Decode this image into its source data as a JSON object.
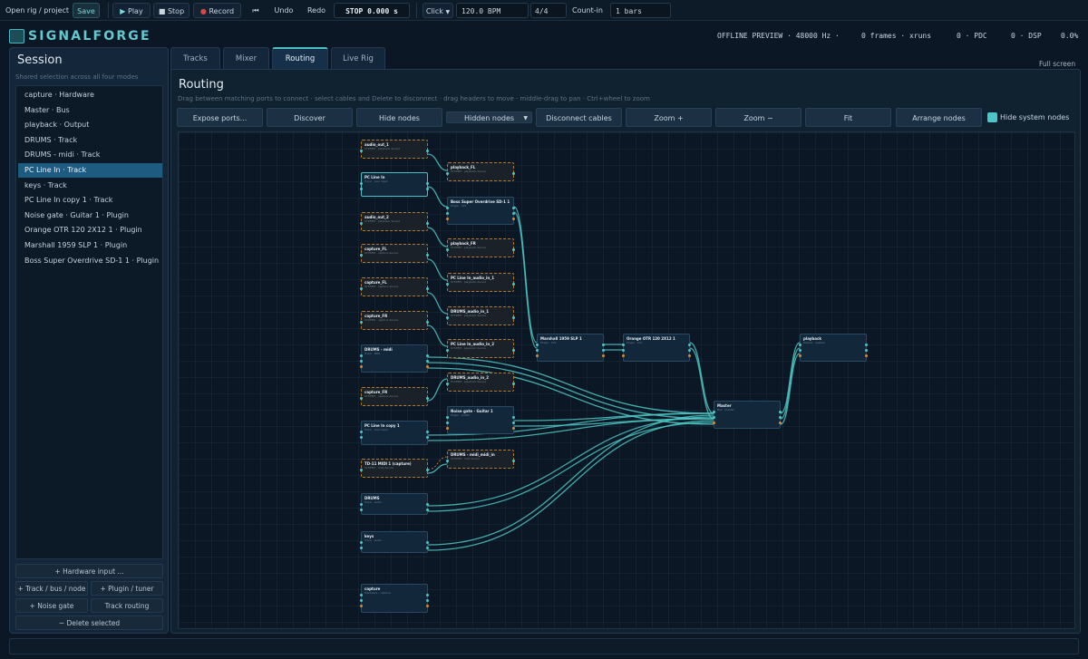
{
  "toolbar": {
    "open": "Open rig / project",
    "save": "Save",
    "play": "Play",
    "stop": "Stop",
    "record": "Record",
    "undo": "Undo",
    "redo": "Redo",
    "transport": "STOP 0.000 s",
    "click": "Click",
    "bpm": "120.0 BPM",
    "meter": "4/4",
    "countin_label": "Count-in",
    "countin_value": "1 bars"
  },
  "app": {
    "name": "SIGNALFORGE"
  },
  "status": {
    "mode": "OFFLINE PREVIEW · 48000 Hz ·",
    "frames": "0 frames · xruns",
    "pdc": "0 · PDC",
    "dsp": "0 · DSP",
    "load": "0.0%"
  },
  "session": {
    "title": "Session",
    "subtitle": "Shared selection across all four modes",
    "items": [
      "capture · Hardware",
      "Master · Bus",
      "playback · Output",
      "DRUMS · Track",
      "DRUMS - midi · Track",
      "PC Line In · Track",
      "keys · Track",
      "PC Line In copy 1 · Track",
      "Noise gate · Guitar 1 · Plugin",
      "Orange OTR 120 2X12 1 · Plugin",
      "Marshall 1959 SLP 1 · Plugin",
      "Boss Super Overdrive SD-1 1 · Plugin"
    ],
    "selected_index": 5,
    "buttons": {
      "hardware_input": "+ Hardware input ...",
      "track_bus": "+ Track / bus / node",
      "plugin_tuner": "+ Plugin / tuner",
      "noise_gate": "+ Noise gate",
      "track_routing": "Track routing",
      "delete": "− Delete selected"
    }
  },
  "tabs": [
    "Tracks",
    "Mixer",
    "Routing",
    "Live Rig"
  ],
  "active_tab": "Routing",
  "fullscreen": "Full screen",
  "routing": {
    "title": "Routing",
    "help": "Drag between matching ports to connect · select cables and Delete to disconnect · drag headers to move · middle-drag to pan · Ctrl+wheel to zoom",
    "actions": {
      "expose": "Expose ports...",
      "discover": "Discover",
      "hide_nodes": "Hide nodes",
      "hidden_nodes": "Hidden nodes",
      "disconnect": "Disconnect cables",
      "zoom_in": "Zoom +",
      "zoom_out": "Zoom −",
      "fit": "Fit",
      "arrange": "Arrange nodes",
      "hide_system": "Hide system nodes"
    },
    "nodes": [
      {
        "id": "n1",
        "title": "audio_out_1",
        "sub": "SYSTEM · playback device",
        "hw": true
      },
      {
        "id": "n2",
        "title": "PC Line In",
        "sub": "Track · Line input",
        "hw": false,
        "sel": true
      },
      {
        "id": "n3",
        "title": "audio_out_2",
        "sub": "SYSTEM · playback device",
        "hw": true
      },
      {
        "id": "n4",
        "title": "capture_FL",
        "sub": "SYSTEM · capture device",
        "hw": true
      },
      {
        "id": "n5",
        "title": "capture_FL",
        "sub": "SYSTEM · capture device",
        "hw": true
      },
      {
        "id": "n6",
        "title": "capture_FR",
        "sub": "SYSTEM · capture device",
        "hw": true
      },
      {
        "id": "n7",
        "title": "DRUMS - midi",
        "sub": "Track · MIDI",
        "hw": false
      },
      {
        "id": "n8",
        "title": "capture_FR",
        "sub": "SYSTEM · capture device",
        "hw": true
      },
      {
        "id": "n9",
        "title": "PC Line In copy 1",
        "sub": "Track · Line input",
        "hw": false
      },
      {
        "id": "n10",
        "title": "TD-11 MIDI 1 (capture)",
        "sub": "SYSTEM · midi device",
        "hw": true
      },
      {
        "id": "n11",
        "title": "DRUMS",
        "sub": "Track · audio",
        "hw": false
      },
      {
        "id": "n12",
        "title": "keys",
        "sub": "Track · audio",
        "hw": false
      },
      {
        "id": "n13",
        "title": "capture",
        "sub": "Hardware · capture",
        "hw": false
      },
      {
        "id": "n14",
        "title": "playback_FL",
        "sub": "SYSTEM · playback device",
        "hw": true
      },
      {
        "id": "n15",
        "title": "Boss Super Overdrive SD-1 1",
        "sub": "Plugin · LV2",
        "hw": false
      },
      {
        "id": "n16",
        "title": "playback_FR",
        "sub": "SYSTEM · playback device",
        "hw": true
      },
      {
        "id": "n17",
        "title": "PC Line In_audio_in_1",
        "sub": "SYSTEM · playback device",
        "hw": true
      },
      {
        "id": "n18",
        "title": "DRUMS_audio_in_1",
        "sub": "SYSTEM · playback device",
        "hw": true
      },
      {
        "id": "n19",
        "title": "PC Line In_audio_in_2",
        "sub": "SYSTEM · playback device",
        "hw": true
      },
      {
        "id": "n20",
        "title": "DRUMS_audio_in_2",
        "sub": "SYSTEM · playback device",
        "hw": true
      },
      {
        "id": "n21",
        "title": "Noise gate · Guitar 1",
        "sub": "Plugin · builtin",
        "hw": false
      },
      {
        "id": "n22",
        "title": "DRUMS - midi_midi_in",
        "sub": "SYSTEM · midi device",
        "hw": true
      },
      {
        "id": "n23",
        "title": "Marshall 1959 SLP 1",
        "sub": "Plugin · LV2",
        "hw": false
      },
      {
        "id": "n24",
        "title": "Orange OTR 120 2X12 1",
        "sub": "Plugin · LV2",
        "hw": false
      },
      {
        "id": "n25",
        "title": "Master",
        "sub": "Bus · master",
        "hw": false
      },
      {
        "id": "n26",
        "title": "playback",
        "sub": "Output · system",
        "hw": false
      }
    ]
  },
  "colors": {
    "accent": "#4fbfc6",
    "cable": "#4ec7c4",
    "hw_border": "#b37a2c",
    "selection": "#1e5b80"
  }
}
